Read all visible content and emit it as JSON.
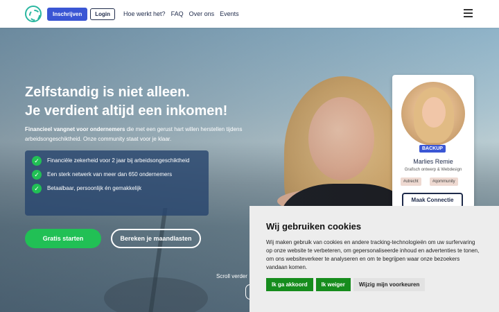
{
  "header": {
    "signup_label": "Inschrijven",
    "login_label": "Login",
    "nav": [
      "Hoe werkt het?",
      "FAQ",
      "Over ons",
      "Events"
    ],
    "logo_icon": "circle-logo-icon",
    "menu_icon": "hamburger-menu-icon"
  },
  "hero": {
    "title_line1": "Zelfstandig is niet alleen.",
    "title_line2": "Je verdient altijd een inkomen!",
    "subtitle_bold": "Financieel vangnet voor ondernemers",
    "subtitle_rest": " die met een gerust hart willen herstellen tijdens arbeidsongeschiktheid. Onze community staat voor je klaar.",
    "features": [
      "Financiële zekerheid voor 2 jaar bij arbeidsongeschiktheid",
      "Een sterk netwerk van meer dan 650 ondernemers",
      "Betaalbaar, persoonlijk én gemakkelijk"
    ],
    "start_label": "Gratis starten",
    "calc_label": "Bereken je maandlasten",
    "scroll_label": "Scroll verder"
  },
  "card": {
    "badge": "BACKUP",
    "name": "Marlies Remie",
    "role": "Grafisch ontwerp & Webdesign",
    "tags": [
      "#utrecht",
      "#qommunity"
    ],
    "button_label": "Maak Connectie"
  },
  "cookie": {
    "title": "Wij gebruiken cookies",
    "text": "Wij maken gebruik van cookies en andere tracking-technologieën om uw surfervaring op onze website te verbeteren, om gepersonaliseerde inhoud en advertenties te tonen, om ons websiteverkeer te analyseren en om te begrijpen waar onze bezoekers vandaan komen.",
    "accept_label": "Ik ga akkoord",
    "refuse_label": "Ik weiger",
    "prefs_label": "Wijzig mijn voorkeuren"
  },
  "colors": {
    "primary_blue": "#3a56d4",
    "green": "#21c055",
    "cookie_green": "#168c1d",
    "navy": "#1e2a4a"
  }
}
